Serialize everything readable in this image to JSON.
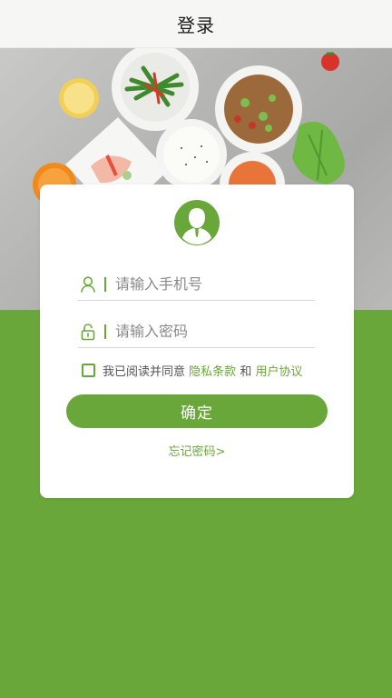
{
  "header": {
    "title": "登录"
  },
  "login": {
    "phone_placeholder": "请输入手机号",
    "password_placeholder": "请输入密码",
    "agree_prefix": "我已阅读并同意",
    "privacy_link": "隐私条款",
    "agree_and": "和",
    "user_agreement_link": "用户协议",
    "confirm_label": "确定",
    "forgot_label": "忘记密码>"
  },
  "colors": {
    "accent": "#6aa73a",
    "header_bg": "#f6f6f4",
    "card_bg": "#ffffff"
  },
  "icons": {
    "avatar": "user-avatar-icon",
    "phone_field": "user-icon",
    "password_field": "lock-icon"
  }
}
